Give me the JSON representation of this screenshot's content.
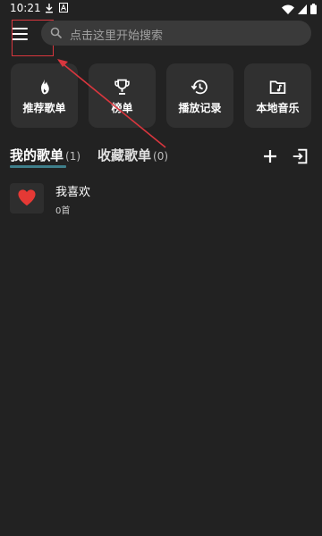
{
  "status_bar": {
    "time": "10:21"
  },
  "search": {
    "placeholder": "点击这里开始搜索"
  },
  "quick_actions": [
    {
      "label": "推荐歌单",
      "icon": "fire-icon"
    },
    {
      "label": "榜单",
      "icon": "trophy-icon"
    },
    {
      "label": "播放记录",
      "icon": "history-icon"
    },
    {
      "label": "本地音乐",
      "icon": "music-folder-icon"
    }
  ],
  "tabs": [
    {
      "label": "我的歌单",
      "count": "(1)",
      "active": true
    },
    {
      "label": "收藏歌单",
      "count": "(0)",
      "active": false
    }
  ],
  "playlists": [
    {
      "title": "我喜欢",
      "count": "0首",
      "icon": "heart-icon"
    }
  ],
  "colors": {
    "background": "#222222",
    "card": "#303030",
    "search_bg": "#3a3a3a",
    "tab_underline": "#3f7f8b",
    "highlight_red": "#d9363e",
    "heart_red": "#e53935"
  }
}
